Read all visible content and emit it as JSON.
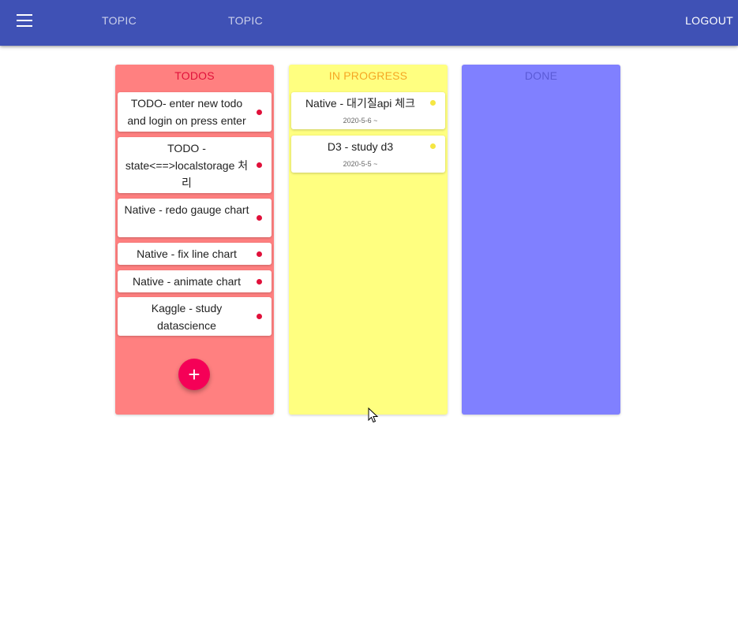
{
  "appbar": {
    "menu_icon": "menu-icon",
    "nav": [
      "TOPIC",
      "TOPIC"
    ],
    "logout_label": "LOGOUT",
    "color": "#3f51b5"
  },
  "columns": [
    {
      "title": "TODOS",
      "color": "#ff8080",
      "title_color": "#e0103a",
      "dot_color": "#e0103a",
      "cards": [
        {
          "text": "TODO- enter new todo and login on press enter"
        },
        {
          "text": "TODO - state<==>localstorage 처리"
        },
        {
          "text": "Native - redo gauge chart"
        },
        {
          "text": "Native - fix line chart"
        },
        {
          "text": "Native - animate chart"
        },
        {
          "text": "Kaggle - study datascience"
        }
      ],
      "fab_icon": "plus-icon",
      "fab_label": "+"
    },
    {
      "title": "IN PROGRESS",
      "color": "#ffff80",
      "title_color": "#f5a623",
      "dot_color": "#f5e642",
      "cards": [
        {
          "text": "Native - 대기질api 체크",
          "date": "2020-5-6 ~"
        },
        {
          "text": "D3 - study d3",
          "date": "2020-5-5 ~"
        }
      ]
    },
    {
      "title": "DONE",
      "color": "#8080ff",
      "title_color": "#5a5ad6",
      "cards": []
    }
  ]
}
